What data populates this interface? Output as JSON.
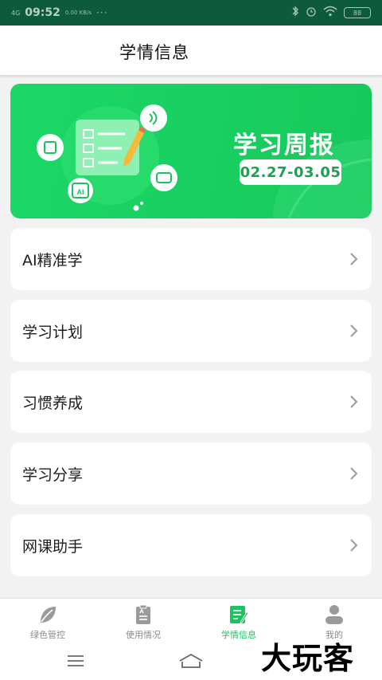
{
  "status_bar": {
    "network": "4G",
    "time": "09:52",
    "speed": "0.00 KB/s",
    "dots": "···",
    "battery": "88"
  },
  "header": {
    "title": "学情信息"
  },
  "banner": {
    "title": "学习周报",
    "date_range": "02.27-03.05",
    "ai_badge": "AI"
  },
  "menu": {
    "items": [
      {
        "label": "AI精准学"
      },
      {
        "label": "学习计划"
      },
      {
        "label": "习惯养成"
      },
      {
        "label": "学习分享"
      },
      {
        "label": "网课助手"
      }
    ]
  },
  "tabbar": {
    "tabs": [
      {
        "label": "绿色管控",
        "active": false
      },
      {
        "label": "使用情况",
        "active": false
      },
      {
        "label": "学情信息",
        "active": true
      },
      {
        "label": "我的",
        "active": false
      }
    ]
  },
  "watermark": "大玩客",
  "colors": {
    "accent": "#1bc45e",
    "status_bar": "#0e5a3e",
    "banner": "#1bd866"
  }
}
